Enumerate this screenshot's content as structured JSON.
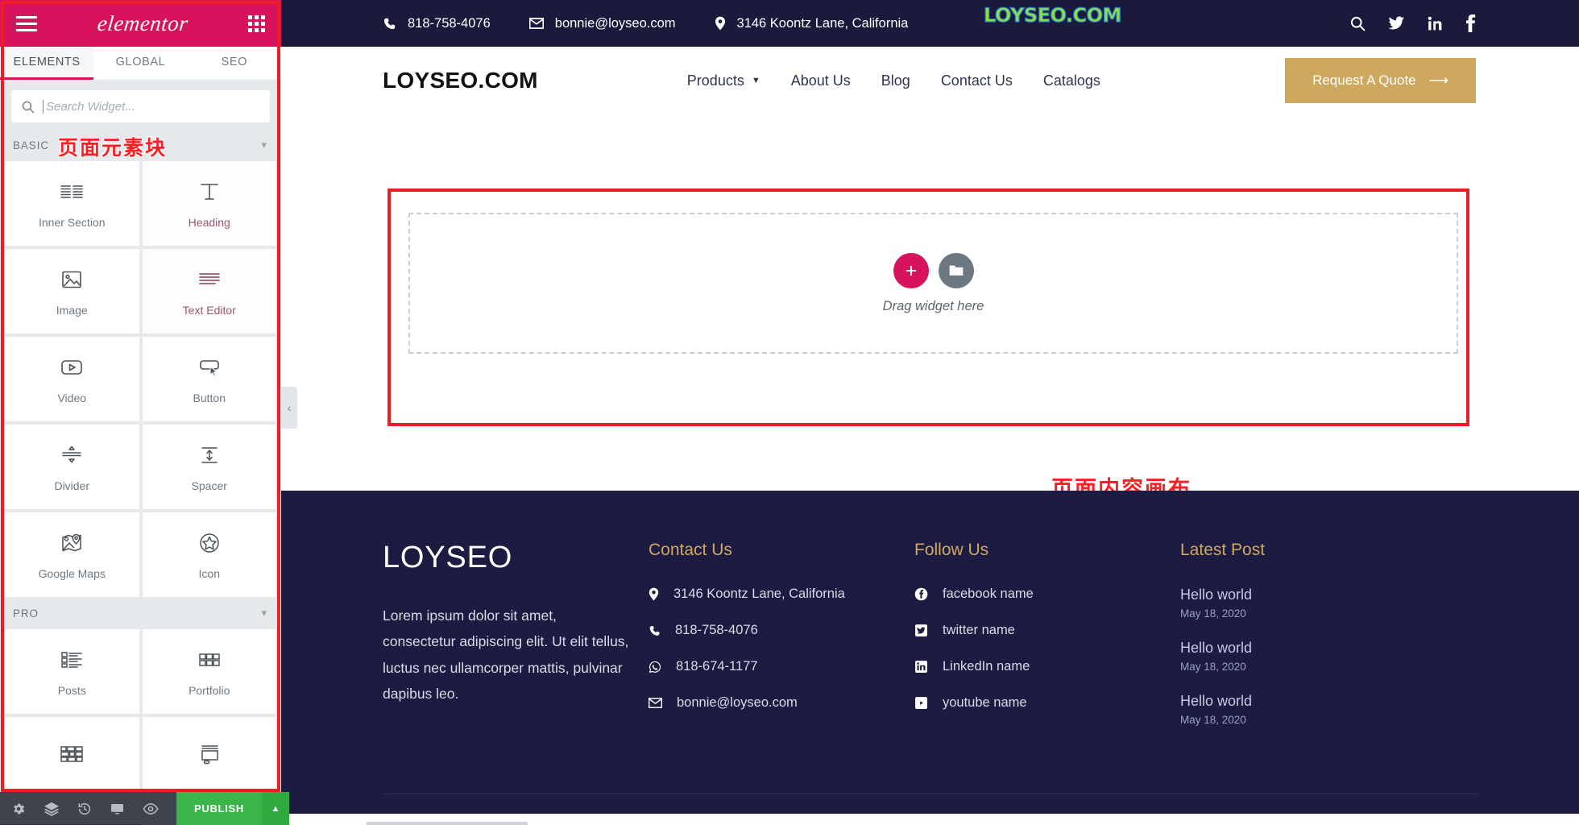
{
  "editor": {
    "logo_text": "elementor",
    "menu_icon": "hamburger-icon",
    "apps_icon": "grid-apps-icon",
    "tabs": [
      {
        "label": "ELEMENTS",
        "active": true
      },
      {
        "label": "GLOBAL",
        "active": false
      },
      {
        "label": "SEO",
        "active": false
      }
    ],
    "search": {
      "placeholder": "Search Widget...",
      "value": "",
      "icon": "search-icon"
    },
    "annotation_panel": "页面元素块",
    "annotation_canvas": "页面内容画布",
    "categories": [
      {
        "name": "BASIC",
        "collapse_icon": "chevron-down-icon",
        "widgets": [
          {
            "label": "Inner Section",
            "icon": "inner-section-icon",
            "tinted": false
          },
          {
            "label": "Heading",
            "icon": "heading-icon",
            "tinted": true
          },
          {
            "label": "Image",
            "icon": "image-icon",
            "tinted": false
          },
          {
            "label": "Text Editor",
            "icon": "text-editor-icon",
            "tinted": true
          },
          {
            "label": "Video",
            "icon": "video-icon",
            "tinted": false
          },
          {
            "label": "Button",
            "icon": "button-icon",
            "tinted": false
          },
          {
            "label": "Divider",
            "icon": "divider-icon",
            "tinted": false
          },
          {
            "label": "Spacer",
            "icon": "spacer-icon",
            "tinted": false
          },
          {
            "label": "Google Maps",
            "icon": "google-maps-icon",
            "tinted": false
          },
          {
            "label": "Icon",
            "icon": "star-icon",
            "tinted": false
          }
        ]
      },
      {
        "name": "PRO",
        "collapse_icon": "chevron-down-icon",
        "widgets": [
          {
            "label": "Posts",
            "icon": "posts-icon",
            "tinted": false
          },
          {
            "label": "Portfolio",
            "icon": "portfolio-icon",
            "tinted": false
          },
          {
            "label": "",
            "icon": "gallery-icon",
            "tinted": false
          },
          {
            "label": "",
            "icon": "slides-icon",
            "tinted": false
          }
        ]
      }
    ],
    "bottom_bar": {
      "settings_icon": "gear-icon",
      "navigator_icon": "layers-icon",
      "history_icon": "history-icon",
      "responsive_icon": "monitor-icon",
      "preview_icon": "eye-icon",
      "publish_label": "PUBLISH",
      "publish_caret_icon": "caret-up-icon"
    },
    "collapse_handle_icon": "chevron-left-icon"
  },
  "site": {
    "topbar": {
      "phone": "818-758-4076",
      "phone_icon": "phone-icon",
      "email": "bonnie@loyseo.com",
      "email_icon": "envelope-icon",
      "address": "3146 Koontz Lane, California",
      "address_icon": "map-pin-icon",
      "watermark": "LOYSEO.COM",
      "social": [
        {
          "name": "search-icon"
        },
        {
          "name": "twitter-icon"
        },
        {
          "name": "linkedin-icon"
        },
        {
          "name": "facebook-icon"
        }
      ]
    },
    "nav": {
      "brand": "LOYSEO.COM",
      "links": [
        {
          "label": "Products",
          "has_dropdown": true
        },
        {
          "label": "About Us",
          "has_dropdown": false
        },
        {
          "label": "Blog",
          "has_dropdown": false
        },
        {
          "label": "Contact Us",
          "has_dropdown": false
        },
        {
          "label": "Catalogs",
          "has_dropdown": false
        }
      ],
      "cta": {
        "label": "Request A Quote",
        "icon": "arrow-right-icon",
        "color": "#cfa85f"
      }
    },
    "canvas": {
      "drag_label": "Drag widget here",
      "add_icon": "plus-icon",
      "folder_icon": "folder-icon",
      "add_color": "#d6135c",
      "folder_color": "#6c7781"
    },
    "footer": {
      "logo": "LOYSEO",
      "description": "Lorem ipsum dolor sit amet, consectetur adipiscing elit. Ut elit tellus, luctus nec ullamcorper mattis, pulvinar dapibus leo.",
      "contact": {
        "title": "Contact Us",
        "items": [
          {
            "icon": "map-pin-icon",
            "text": "3146 Koontz Lane, California"
          },
          {
            "icon": "phone-icon",
            "text": "818-758-4076"
          },
          {
            "icon": "whatsapp-icon",
            "text": "818-674-1177"
          },
          {
            "icon": "envelope-icon",
            "text": "bonnie@loyseo.com"
          }
        ]
      },
      "follow": {
        "title": "Follow Us",
        "items": [
          {
            "icon": "facebook-icon",
            "text": "facebook name"
          },
          {
            "icon": "twitter-icon",
            "text": "twitter name"
          },
          {
            "icon": "linkedin-icon",
            "text": "LinkedIn name"
          },
          {
            "icon": "youtube-icon",
            "text": "youtube name"
          }
        ]
      },
      "latest": {
        "title": "Latest Post",
        "posts": [
          {
            "title": "Hello world",
            "date": "May 18, 2020"
          },
          {
            "title": "Hello world",
            "date": "May 18, 2020"
          },
          {
            "title": "Hello world",
            "date": "May 18, 2020"
          }
        ]
      },
      "accent_color": "#d2a75e",
      "background": "#1c1c42"
    }
  }
}
